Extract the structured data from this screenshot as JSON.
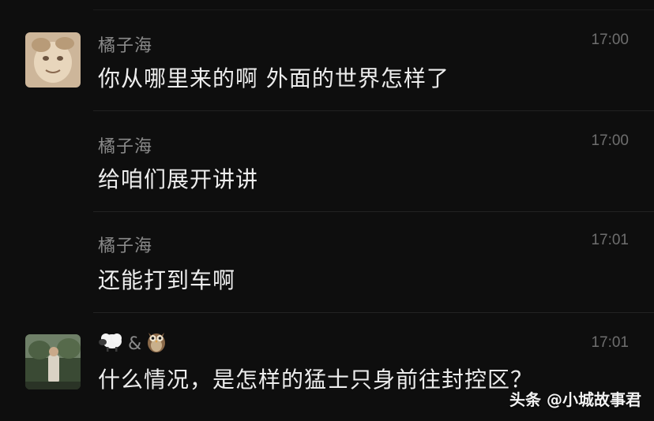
{
  "messages": [
    {
      "sender": "橘子海",
      "time": "17:00",
      "text": "你从哪里来的啊 外面的世界怎样了"
    },
    {
      "sender": "橘子海",
      "time": "17:00",
      "text": "给咱们展开讲讲"
    },
    {
      "sender": "橘子海",
      "time": "17:01",
      "text": "还能打到车啊"
    },
    {
      "sender": "&",
      "time": "17:01",
      "text": "什么情况，是怎样的猛士只身前往封控区？"
    }
  ],
  "watermark": {
    "brand": "头条",
    "handle": "@小城故事君"
  },
  "colors": {
    "background": "#0e0e0e",
    "name": "#8a8a8a",
    "text": "#ededed",
    "time": "#6e6e6e"
  },
  "icons": [
    "sheep-emoji-icon",
    "owl-emoji-icon"
  ]
}
